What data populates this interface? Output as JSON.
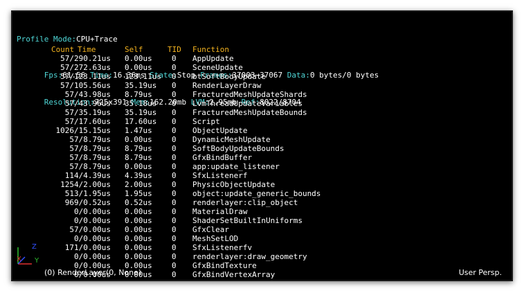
{
  "header": {
    "line1": {
      "label": "Profile Mode:",
      "value": "CPU+Trace"
    },
    "line2": [
      {
        "label": "Fps:",
        "value": "61.56"
      },
      {
        "label": " Time:",
        "value": "16.36ms"
      },
      {
        "label": " State:",
        "value": "Stop"
      },
      {
        "label": " Frames:",
        "value": "37003~37067"
      },
      {
        "label": " Data:",
        "value": "0 bytes/0 bytes"
      }
    ],
    "line3": [
      {
        "label": "Resolution:",
        "value": "725x391"
      },
      {
        "label": " Mem:",
        "value": "162.20mb"
      },
      {
        "label": " LVM:",
        "value": "2.95mb"
      },
      {
        "label": " Ref:",
        "value": "8022/8704"
      }
    ]
  },
  "columns": {
    "count": "Count",
    "time": "Time",
    "self": "Self",
    "tid": "TID",
    "function": "Function"
  },
  "rows": [
    {
      "count_time": "57/290.21us",
      "self": "0.00us",
      "tid": "0",
      "function": "AppUpdate"
    },
    {
      "count_time": "57/272.63us",
      "self": "0.00us",
      "tid": "0",
      "function": "SceneUpdate"
    },
    {
      "count_time": "57/123.11us",
      "self": "123.11us",
      "tid": "0",
      "function": "btSoftBodyUpdate"
    },
    {
      "count_time": "57/105.56us",
      "self": "35.19us",
      "tid": "0",
      "function": "RenderLayerDraw"
    },
    {
      "count_time": "57/43.98us",
      "self": "8.79us",
      "tid": "0",
      "function": "FracturedMeshUpdateShards"
    },
    {
      "count_time": "57/43.96us",
      "self": "35.18us",
      "tid": "0",
      "function": "LvmThreadUpdateVariables"
    },
    {
      "count_time": "57/35.19us",
      "self": "35.19us",
      "tid": "0",
      "function": "FracturedMeshUpdateBounds"
    },
    {
      "count_time": "57/17.60us",
      "self": "17.60us",
      "tid": "0",
      "function": "Script"
    },
    {
      "count_time": "1026/15.15us",
      "self": "1.47us",
      "tid": "0",
      "function": "ObjectUpdate"
    },
    {
      "count_time": "57/8.79us",
      "self": "0.00us",
      "tid": "0",
      "function": "DynamicMeshUpdate"
    },
    {
      "count_time": "57/8.79us",
      "self": "8.79us",
      "tid": "0",
      "function": "SoftBodyUpdateBounds"
    },
    {
      "count_time": "57/8.79us",
      "self": "8.79us",
      "tid": "0",
      "function": "GfxBindBuffer"
    },
    {
      "count_time": "57/8.79us",
      "self": "0.00us",
      "tid": "0",
      "function": "app:update_listener"
    },
    {
      "count_time": "114/4.39us",
      "self": "4.39us",
      "tid": "0",
      "function": "SfxListenerf"
    },
    {
      "count_time": "1254/2.00us",
      "self": "2.00us",
      "tid": "0",
      "function": "PhysicObjectUpdate"
    },
    {
      "count_time": "513/1.95us",
      "self": "1.95us",
      "tid": "0",
      "function": "object:update_generic_bounds"
    },
    {
      "count_time": "969/0.52us",
      "self": "0.52us",
      "tid": "0",
      "function": "renderlayer:clip_object"
    },
    {
      "count_time": "0/0.00us",
      "self": "0.00us",
      "tid": "0",
      "function": "MaterialDraw"
    },
    {
      "count_time": "0/0.00us",
      "self": "0.00us",
      "tid": "0",
      "function": "ShaderSetBuiltInUniforms"
    },
    {
      "count_time": "57/0.00us",
      "self": "0.00us",
      "tid": "0",
      "function": "GfxClear"
    },
    {
      "count_time": "0/0.00us",
      "self": "0.00us",
      "tid": "0",
      "function": "MeshSetLOD"
    },
    {
      "count_time": "171/0.00us",
      "self": "0.00us",
      "tid": "0",
      "function": "SfxListenerfv"
    },
    {
      "count_time": "0/0.00us",
      "self": "0.00us",
      "tid": "0",
      "function": "renderlayer:draw_geometry"
    },
    {
      "count_time": "0/0.00us",
      "self": "0.00us",
      "tid": "0",
      "function": "GfxBindTexture"
    },
    {
      "count_time": "0/0.00us",
      "self": "0.00us",
      "tid": "0",
      "function": "GfxBindVertexArray"
    }
  ],
  "status": {
    "left": "(0) RenderLayer(0, None)",
    "right": "User Persp."
  },
  "gizmo": {
    "x_label": "X",
    "y_label": "Y",
    "z_label": "Z",
    "x_color": "#e03030",
    "y_color": "#30c030",
    "z_color": "#3050ff"
  }
}
